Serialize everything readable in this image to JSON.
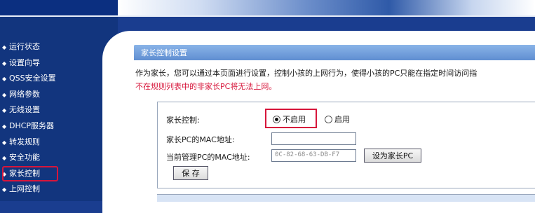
{
  "sidebar": {
    "items": [
      {
        "label": "运行状态"
      },
      {
        "label": "设置向导"
      },
      {
        "label": "QSS安全设置"
      },
      {
        "label": "网络参数"
      },
      {
        "label": "无线设置"
      },
      {
        "label": "DHCP服务器"
      },
      {
        "label": "转发规则"
      },
      {
        "label": "安全功能"
      },
      {
        "label": "家长控制"
      },
      {
        "label": "上网控制"
      }
    ],
    "active_index": 8,
    "bullet_icon": "diamond-bullet-icon"
  },
  "panel": {
    "title": "家长控制设置",
    "description": "作为家长，您可以通过本页面进行设置，控制小孩的上网行为，使得小孩的PC只能在指定时间访问指",
    "warning": "不在规则列表中的非家长PC将无法上网。"
  },
  "form": {
    "control_label": "家长控制:",
    "option_disable": "不启用",
    "option_enable": "启用",
    "selected": "不启用",
    "parent_mac_label": "家长PC的MAC地址:",
    "parent_mac_value": "",
    "current_mac_label": "当前管理PC的MAC地址:",
    "current_mac_value": "0C-82-68-63-DB-F7",
    "set_parent_button": "设为家长PC",
    "save_button": "保 存"
  },
  "colors": {
    "sidebar_bg": "#12357e",
    "highlight_red": "#d7163b",
    "panel_title_bg": "#5f8ed1"
  }
}
